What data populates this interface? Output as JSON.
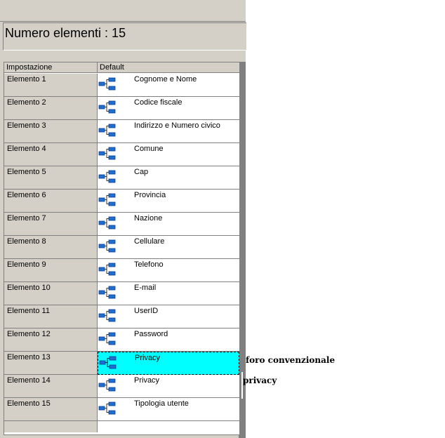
{
  "header": {
    "title": "Numero elementi : 15"
  },
  "grid": {
    "columns": [
      "Impostazione",
      "Default"
    ],
    "rows": [
      {
        "key": "Elemento 1",
        "value": "Cognome e Nome",
        "icon": "tree-node-icon"
      },
      {
        "key": "Elemento 2",
        "value": "Codice fiscale",
        "icon": "tree-node-icon"
      },
      {
        "key": "Elemento 3",
        "value": "Indirizzo e Numero civico",
        "icon": "tree-node-icon"
      },
      {
        "key": "Elemento 4",
        "value": "Comune",
        "icon": "tree-node-icon"
      },
      {
        "key": "Elemento 5",
        "value": "Cap",
        "icon": "tree-node-icon"
      },
      {
        "key": "Elemento 6",
        "value": "Provincia",
        "icon": "tree-node-icon"
      },
      {
        "key": "Elemento 7",
        "value": "Nazione",
        "icon": "tree-node-icon"
      },
      {
        "key": "Elemento 8",
        "value": "Cellulare",
        "icon": "tree-node-icon"
      },
      {
        "key": "Elemento 9",
        "value": "Telefono",
        "icon": "tree-node-icon"
      },
      {
        "key": "Elemento 10",
        "value": "E-mail",
        "icon": "tree-node-icon"
      },
      {
        "key": "Elemento 11",
        "value": "UserID",
        "icon": "tree-node-icon"
      },
      {
        "key": "Elemento 12",
        "value": "Password",
        "icon": "tree-node-icon"
      },
      {
        "key": "Elemento 13",
        "value": "Privacy",
        "icon": "tree-node-icon",
        "selected": true
      },
      {
        "key": "Elemento 14",
        "value": "Privacy",
        "icon": "tree-node-icon"
      },
      {
        "key": "Elemento 15",
        "value": "Tipologia utente",
        "icon": "tree-node-icon"
      }
    ]
  },
  "side_labels": [
    "foro convenzionale",
    "privacy"
  ],
  "colors": {
    "panel": "#d4d0c8",
    "selection": "#00ffff",
    "icon": "#1e6fd0"
  }
}
